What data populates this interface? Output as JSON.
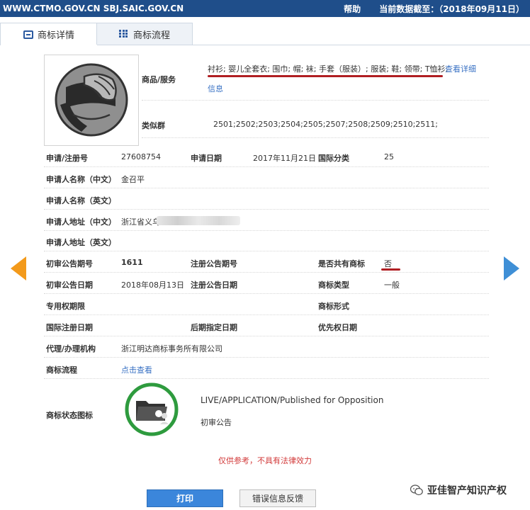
{
  "topbar": {
    "site": "WWW.CTMO.GOV.CN SBJ.SAIC.GOV.CN",
    "help": "帮助",
    "date": "当前数据截至：（2018年09月11日）"
  },
  "tabs": [
    {
      "label": "商标详情",
      "icon": "document-icon"
    },
    {
      "label": "商标流程",
      "icon": "list-icon"
    }
  ],
  "goods": {
    "label": "商品/服务",
    "text": "衬衫; 婴儿全套衣; 围巾; 帽; 袜; 手套（服装）; 服装; 鞋; 领带; T恤衫;",
    "link_part1": "查看详细",
    "link_part2": "信息"
  },
  "similar": {
    "label": "类似群",
    "value": "2501;2502;2503;2504;2505;2507;2508;2509;2510;2511;"
  },
  "fields": {
    "reg_no_label": "申请/注册号",
    "reg_no": "27608754",
    "apply_date_label": "申请日期",
    "apply_date": "2017年11月21日",
    "intl_class_label": "国际分类",
    "intl_class": "25",
    "applicant_cn_label": "申请人名称（中文）",
    "applicant_cn": "金召平",
    "applicant_en_label": "申请人名称（英文）",
    "address_cn_label": "申请人地址（中文）",
    "address_cn": "浙江省义乌",
    "address_en_label": "申请人地址（英文）",
    "prelim_no_label": "初审公告期号",
    "prelim_no": "1611",
    "reg_notice_no_label": "注册公告期号",
    "shared_label": "是否共有商标",
    "shared": "否",
    "prelim_date_label": "初审公告日期",
    "prelim_date": "2018年08月13日",
    "reg_notice_date_label": "注册公告日期",
    "tm_type_label": "商标类型",
    "tm_type": "一般",
    "exclusive_label": "专用权期限",
    "tm_form_label": "商标形式",
    "intl_reg_date_label": "国际注册日期",
    "later_date_label": "后期指定日期",
    "priority_date_label": "优先权日期",
    "agent_label": "代理/办理机构",
    "agent": "浙江明达商标事务所有限公司",
    "flow_label": "商标流程",
    "flow_link": "点击查看",
    "status_label": "商标状态图标"
  },
  "status": {
    "en": "LIVE/APPLICATION/Published for Opposition",
    "cn": "初审公告"
  },
  "disclaimer": "仅供参考，不具有法律效力",
  "buttons": {
    "print": "打印",
    "feedback": "错误信息反馈"
  },
  "watermark": "亚佳智产知识产权",
  "colors": {
    "topbar": "#1f4e8a",
    "primary": "#3b86db",
    "highlight": "#b01e22",
    "status_ring": "#2e9b3e"
  }
}
